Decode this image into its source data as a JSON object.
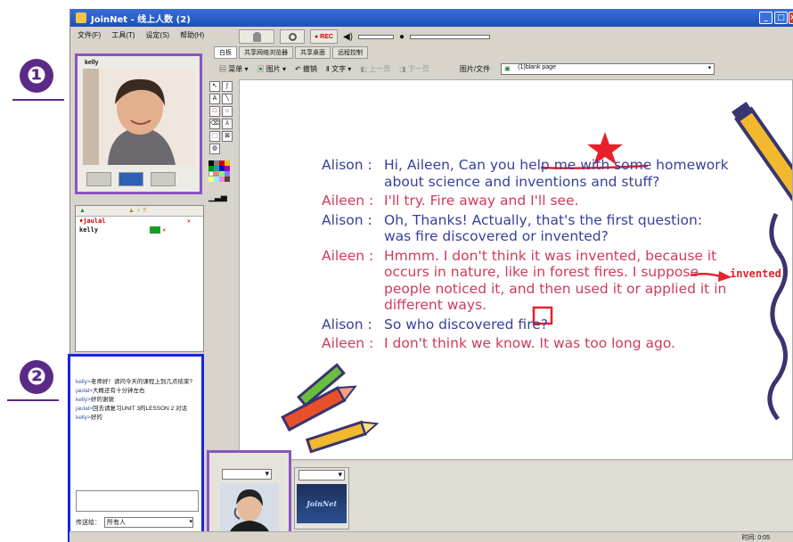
{
  "window": {
    "title": "JoinNet - 线上人数 (2)",
    "controls": [
      "minimize",
      "maximize",
      "close"
    ]
  },
  "menu": [
    "文件(F)",
    "工具(T)",
    "设定(S)",
    "帮助(H)"
  ],
  "top_toolbar": {
    "rec_label": "● REC"
  },
  "annotations": {
    "badge1": "❶",
    "badge2": "❷"
  },
  "video_panel": {
    "user_name": "kelly"
  },
  "user_list": {
    "rows": [
      {
        "name": "♦jaulal"
      },
      {
        "name": "kelly"
      }
    ]
  },
  "chat": {
    "lines": [
      {
        "nick": "kelly>",
        "text": "老师好！请问今天的课程上到几点结束?"
      },
      {
        "nick": "jaulal>",
        "text": "大概还有十分钟左右"
      },
      {
        "nick": "kelly>",
        "text": "好的谢谢"
      },
      {
        "nick": "jaulal>",
        "text": "回去请复习UNIT 3的LESSON 2 对话"
      },
      {
        "nick": "kelly>",
        "text": "好的"
      }
    ],
    "send_to_label": "传送给：",
    "send_to_value": "所有人"
  },
  "tabs": [
    "白板",
    "共享网络浏览器",
    "共享桌面",
    "远程控制"
  ],
  "whiteboard_toolbar": {
    "menu": "菜单",
    "image": "图片",
    "undo": "撤销",
    "text": "文字",
    "prev": "上一页",
    "next": "下一页",
    "page_label": "图片/文件",
    "page_value": "(1)blank page"
  },
  "board": {
    "dialogue": [
      {
        "speaker": "Alison",
        "text": "Hi, Aileen, Can you help me with some homework about science and inventions and stuff?"
      },
      {
        "speaker": "Aileen",
        "text": "I'll try. Fire away and I'll see."
      },
      {
        "speaker": "Alison",
        "text": "Oh, Thanks! Actually, that's the first question: was fire discovered or invented?"
      },
      {
        "speaker": "Aileen",
        "text": "Hmmm. I don't think it was invented, because it occurs in nature, like in forest fires. I suppose people noticed it, and then used it or applied it in different ways."
      },
      {
        "speaker": "Alison",
        "text": "So who discovered fire?"
      },
      {
        "speaker": "Aileen",
        "text": "I don't think we know. It was too long ago."
      }
    ],
    "margin_note": "invented",
    "speaker_colors": {
      "Alison": "#36419a",
      "Aileen": "#d13a5c"
    }
  },
  "thumbnail": {
    "label": "JoinNet"
  },
  "status": {
    "timer": "时间: 0:05"
  }
}
